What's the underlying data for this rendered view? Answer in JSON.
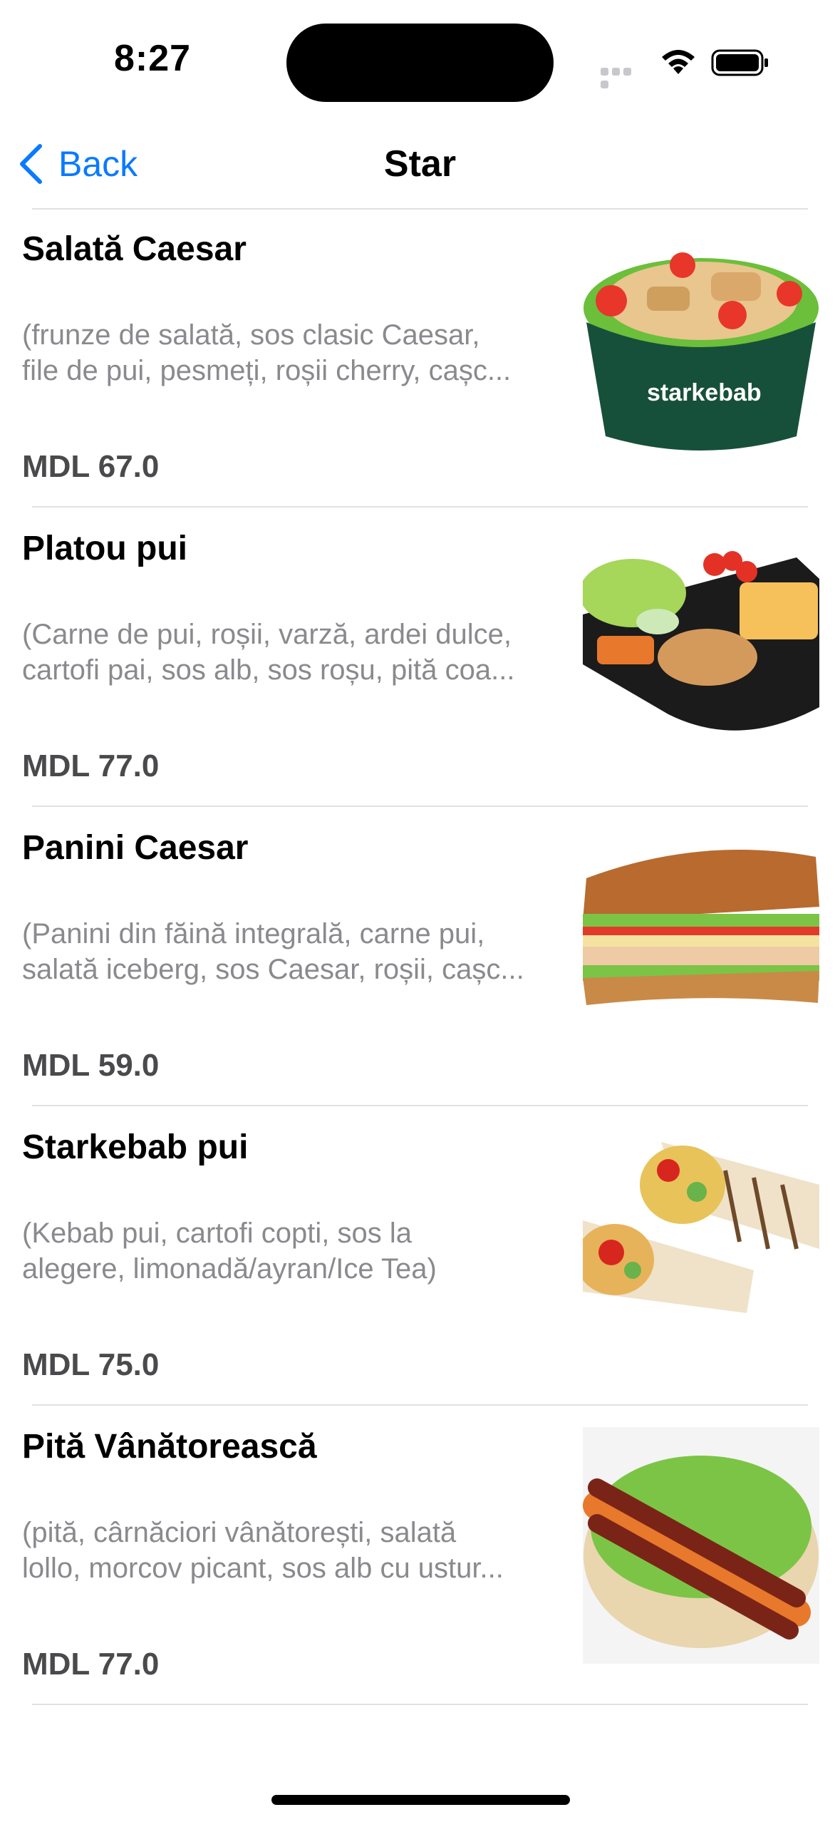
{
  "status_bar": {
    "time": "8:27"
  },
  "nav": {
    "back_label": "Back",
    "title": "Star"
  },
  "items": [
    {
      "name": "Salată Caesar",
      "desc_line1": "(frunze de salată, sos clasic Caesar,",
      "desc_line2": "file de pui, pesmeți, roșii cherry, cașc...",
      "price": "MDL 67.0",
      "image": "caesar-salad-bowl"
    },
    {
      "name": "Platou pui",
      "desc_line1": "(Carne de pui, roșii, varză, ardei dulce,",
      "desc_line2": "cartofi pai, sos alb, sos roșu, pită coa...",
      "price": "MDL 77.0",
      "image": "chicken-platter"
    },
    {
      "name": "Panini Caesar",
      "desc_line1": "(Panini din făină integrală, carne pui,",
      "desc_line2": "salată iceberg, sos Caesar, roșii, cașc...",
      "price": "MDL 59.0",
      "image": "panini-sandwich"
    },
    {
      "name": "Starkebab pui",
      "desc_line1": "(Kebab pui, cartofi copti, sos la",
      "desc_line2": "alegere, limonadă/ayran/Ice Tea)",
      "price": "MDL 75.0",
      "image": "chicken-wrap"
    },
    {
      "name": "Pită Vânătorească",
      "desc_line1": "(pită, cârnăciori vânătorești, salată",
      "desc_line2": "lollo, morcov picant, sos alb cu ustur...",
      "price": "MDL 77.0",
      "image": "sausage-pita"
    }
  ],
  "colors": {
    "accent": "#0a7aff",
    "desc_text": "#8a8a8e",
    "price_text": "#4a4a4c",
    "separator": "#e1e1e4"
  },
  "icons": [
    "back-chevron-icon",
    "wifi-icon",
    "battery-icon",
    "cellular-signal-icon"
  ]
}
